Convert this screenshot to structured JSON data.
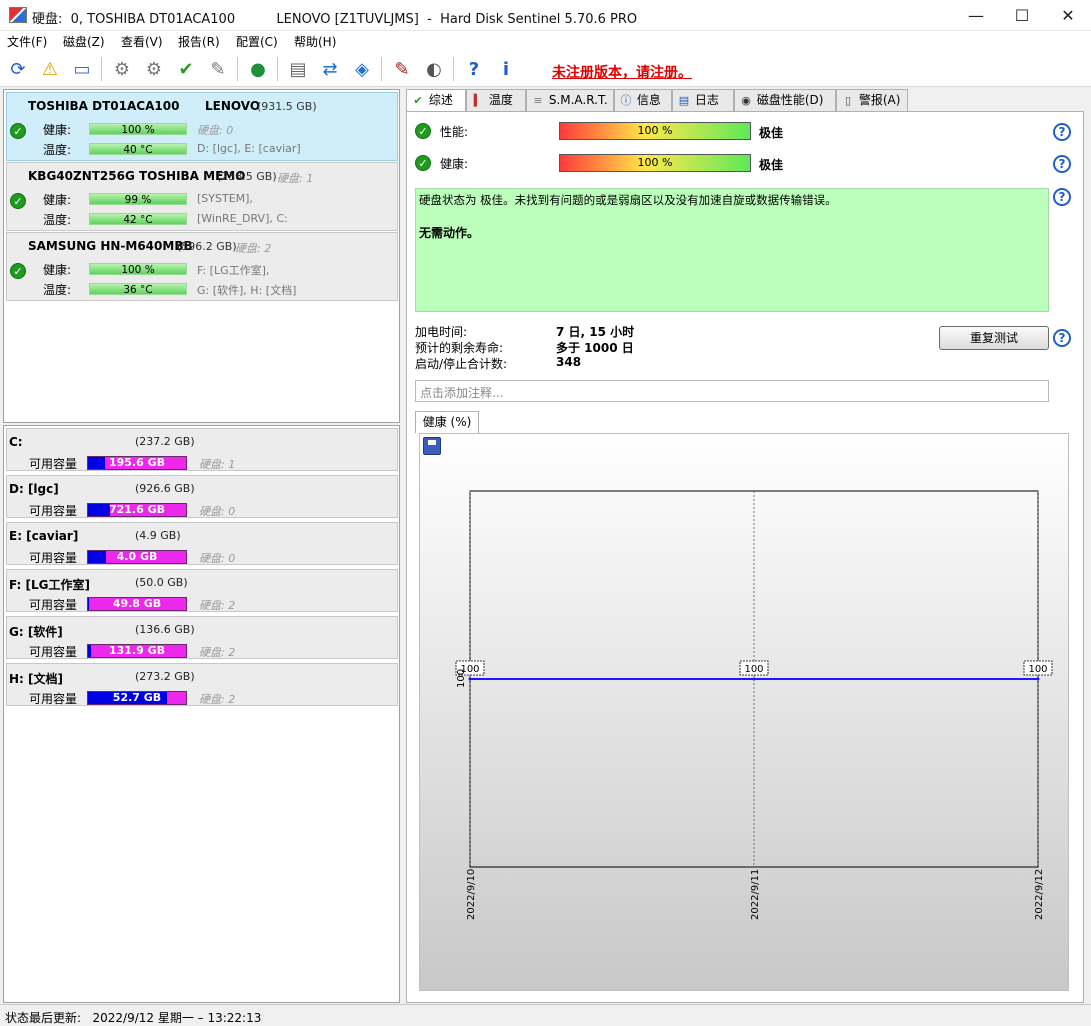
{
  "window": {
    "title": "硬盘:  0, TOSHIBA DT01ACA100          LENOVO [Z1TUVLJMS]  -  Hard Disk Sentinel 5.70.6 PRO",
    "minimize": "—",
    "maximize": "☐",
    "close": "✕"
  },
  "menu": [
    "文件(F)",
    "磁盘(Z)",
    "查看(V)",
    "报告(R)",
    "配置(C)",
    "帮助(H)"
  ],
  "toolbar": {
    "unregistered": "未注册版本，请注册。"
  },
  "disks": [
    {
      "name": "TOSHIBA DT01ACA100",
      "vendor": "LENOVO",
      "size": "(931.5 GB)",
      "disk_no": "硬盘: 0",
      "health_label": "健康:",
      "health": "100 %",
      "temp_label": "温度:",
      "temp": "40 °C",
      "vols1": "",
      "vols2": "D: [lgc], E: [caviar]"
    },
    {
      "name": "KBG40ZNT256G TOSHIBA MEMO",
      "vendor": "",
      "size": "(238.5 GB)",
      "disk_no": "硬盘: 1",
      "health_label": "健康:",
      "health": "99 %",
      "temp_label": "温度:",
      "temp": "42 °C",
      "vols1": "[SYSTEM],",
      "vols2": "[WinRE_DRV], C:"
    },
    {
      "name": "SAMSUNG HN-M640MBB",
      "vendor": "",
      "size": "(596.2 GB)",
      "disk_no": "硬盘: 2",
      "health_label": "健康:",
      "health": "100 %",
      "temp_label": "温度:",
      "temp": "36 °C",
      "vols1": "F: [LG工作室],",
      "vols2": "G: [软件], H: [文档]"
    }
  ],
  "volumes": [
    {
      "name": "C:",
      "size": "(237.2 GB)",
      "free_label": "可用容量",
      "free": "195.6 GB",
      "free_frac": 0.1754,
      "disk": "硬盘: 1"
    },
    {
      "name": "D: [lgc]",
      "size": "(926.6 GB)",
      "free_label": "可用容量",
      "free": "721.6 GB",
      "free_frac": 0.2212,
      "disk": "硬盘: 0"
    },
    {
      "name": "E: [caviar]",
      "size": "(4.9 GB)",
      "free_label": "可用容量",
      "free": "4.0 GB",
      "free_frac": 0.1837,
      "disk": "硬盘: 0"
    },
    {
      "name": "F: [LG工作室]",
      "size": "(50.0 GB)",
      "free_label": "可用容量",
      "free": "49.8 GB",
      "free_frac": 0.004,
      "disk": "硬盘: 2"
    },
    {
      "name": "G: [软件]",
      "size": "(136.6 GB)",
      "free_label": "可用容量",
      "free": "131.9 GB",
      "free_frac": 0.0344,
      "disk": "硬盘: 2"
    },
    {
      "name": "H: [文档]",
      "size": "(273.2 GB)",
      "free_label": "可用容量",
      "free": "52.7 GB",
      "free_frac": 0.8071,
      "disk": "硬盘: 2"
    }
  ],
  "tabs": [
    "综述",
    "温度",
    "S.M.A.R.T.",
    "信息",
    "日志",
    "磁盘性能(D)",
    "警报(A)"
  ],
  "overview": {
    "perf_label": "性能:",
    "perf_value": "100 %",
    "perf_rating": "极佳",
    "health_label": "健康:",
    "health_value": "100 %",
    "health_rating": "极佳",
    "status_text": "硬盘状态为 极佳。未找到有问题的或是弱扇区以及没有加速自旋或数据传输错误。",
    "action_text": "无需动作。",
    "power_on_label": "加电时间:",
    "power_on": "7 日, 15 小时",
    "remaining_label": "预计的剩余寿命:",
    "remaining": "多于 1000 日",
    "startstop_label": "启动/停止合计数:",
    "startstop": "348",
    "retest_button": "重复测试",
    "note_placeholder": "点击添加注释...",
    "chart_tab": "健康 (%)"
  },
  "chart_data": {
    "type": "line",
    "x": [
      "2022/9/10",
      "2022/9/11",
      "2022/9/12"
    ],
    "series": [
      {
        "values": [
          100,
          100,
          100
        ]
      }
    ],
    "ytick": "100",
    "ylim": [
      0,
      200
    ],
    "grid": true,
    "line_color": "#1a1aff"
  },
  "statusbar": {
    "text": "状态最后更新:   2022/9/12 星期一 – 13:22:13"
  },
  "colors": {
    "accent": "#1f5fcc",
    "status_bg": "#bbffbb",
    "unregistered": "#e00000"
  }
}
